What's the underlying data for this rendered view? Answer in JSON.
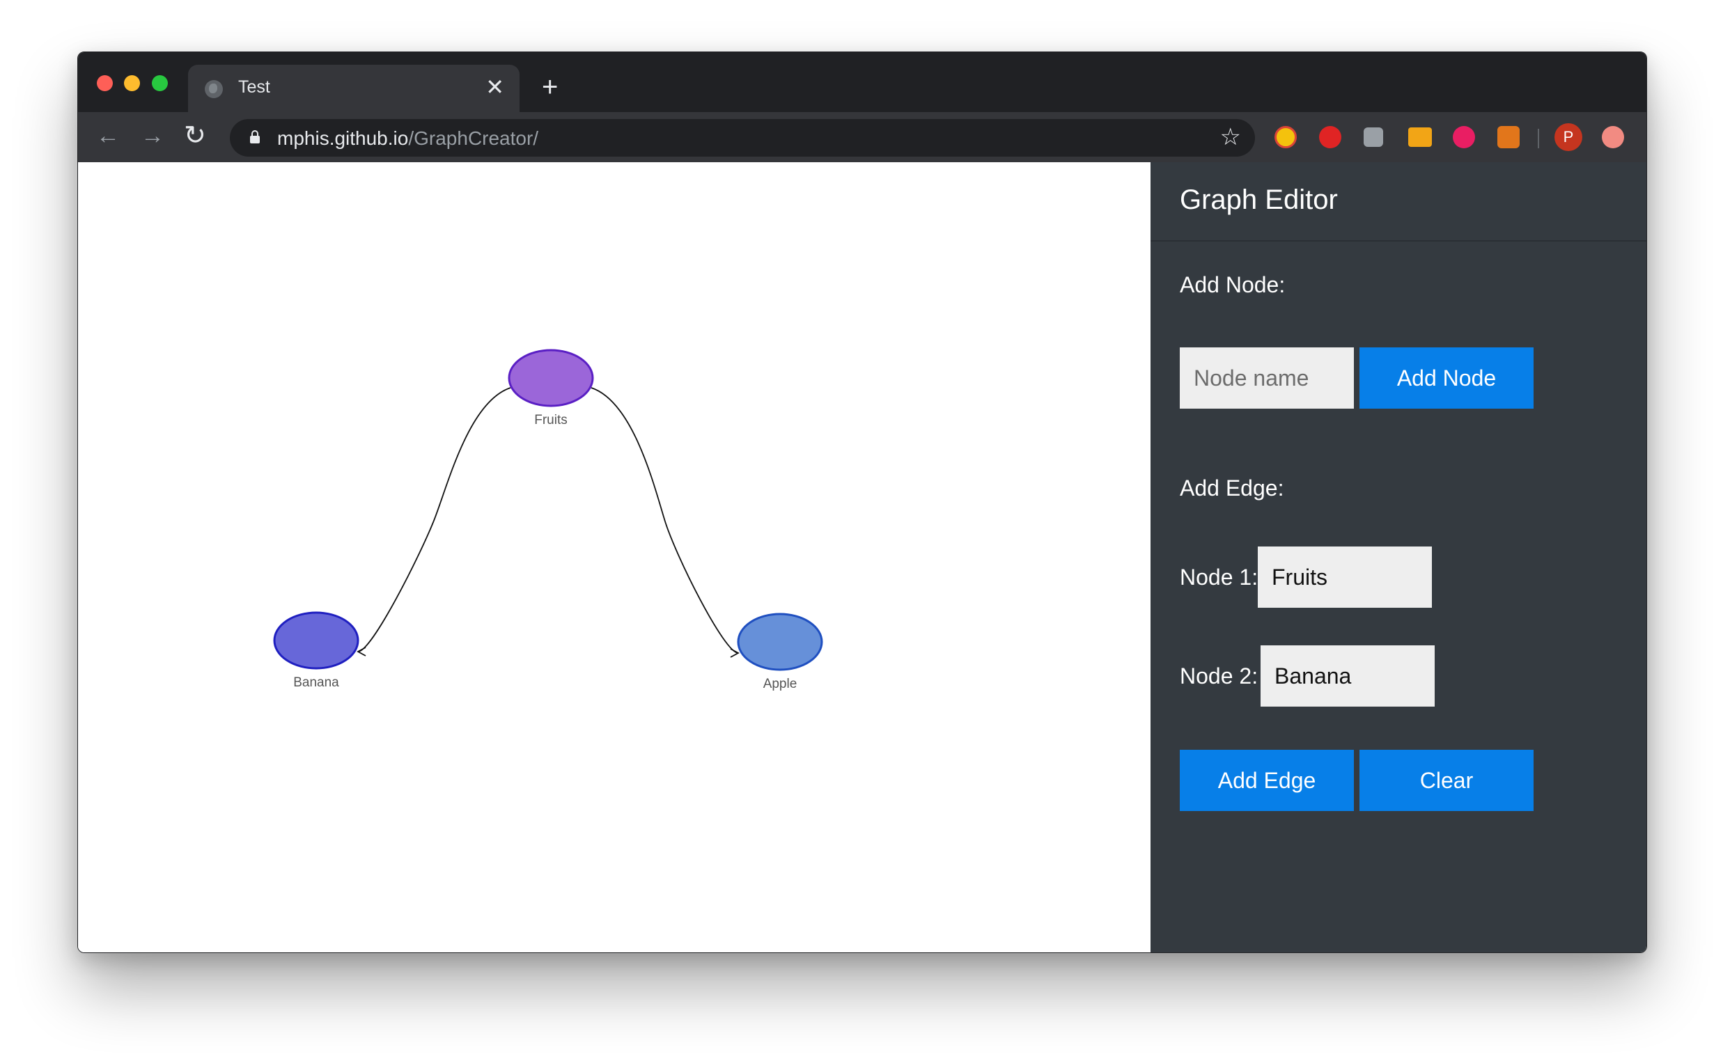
{
  "browser": {
    "tab_title": "Test",
    "tab_close": "✕",
    "new_tab": "+",
    "url_host": "mphis.github.io",
    "url_path": "/GraphCreator/",
    "nav_back": "←",
    "nav_forward": "→",
    "nav_reload": "↻",
    "bookmark": "☆",
    "profile_initial": "P"
  },
  "graph": {
    "nodes": [
      {
        "id": "Fruits",
        "label": "Fruits",
        "color": "#9b66d9"
      },
      {
        "id": "Banana",
        "label": "Banana",
        "color": "#6767d9"
      },
      {
        "id": "Apple",
        "label": "Apple",
        "color": "#6690d9"
      }
    ],
    "edges": [
      {
        "from": "Fruits",
        "to": "Banana"
      },
      {
        "from": "Fruits",
        "to": "Apple"
      }
    ]
  },
  "editor": {
    "title": "Graph Editor",
    "add_node_label": "Add Node:",
    "node_name_placeholder": "Node name",
    "add_node_button": "Add Node",
    "add_edge_label": "Add Edge:",
    "node1_label": "Node 1:",
    "node1_value": "Fruits",
    "node2_label": "Node 2:",
    "node2_value": "Banana",
    "add_edge_button": "Add Edge",
    "clear_button": "Clear"
  },
  "colors": {
    "accent": "#077fe8",
    "panel_bg": "#343a40"
  }
}
